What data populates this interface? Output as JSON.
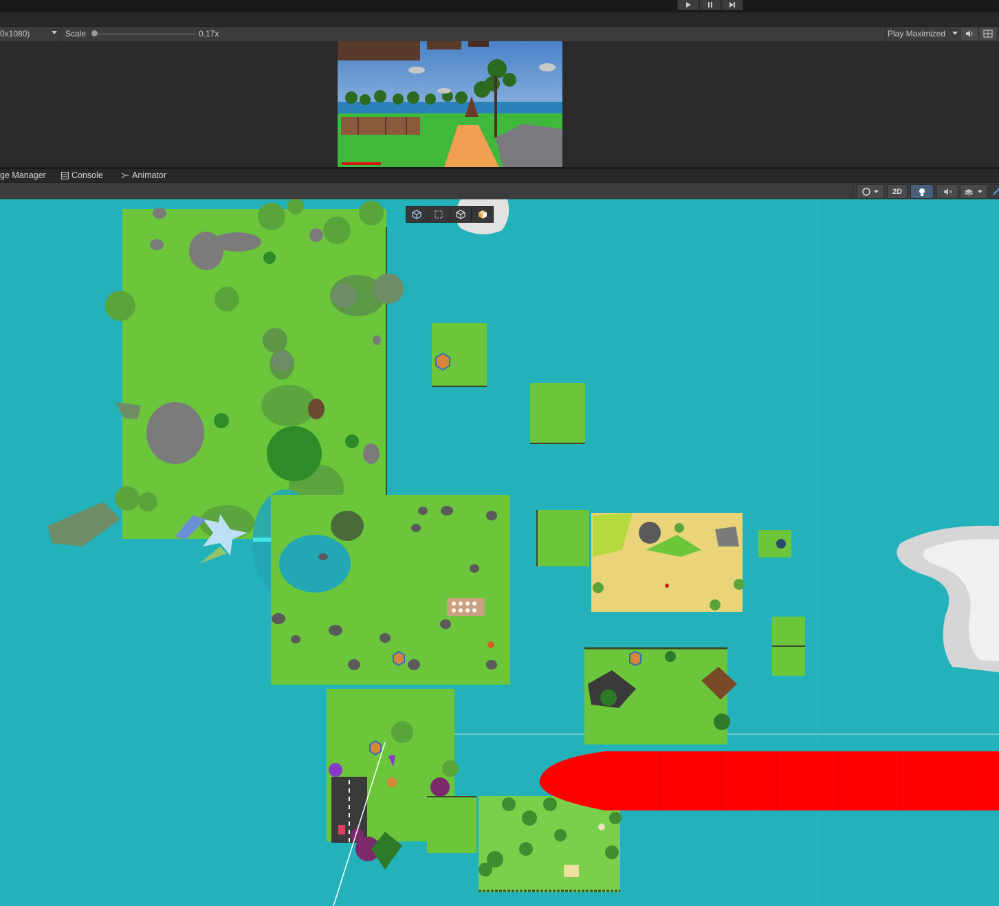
{
  "play_toolbar": {
    "play_icon": "play-icon",
    "pause_icon": "pause-icon",
    "step_icon": "step-icon"
  },
  "game_toolbar": {
    "resolution": "0x1080)",
    "scale_label": "Scale",
    "scale_value": "0.17x",
    "play_mode": "Play Maximized",
    "mute_icon": "speaker-icon",
    "stats_icon": "grid-icon"
  },
  "tabs": [
    {
      "label": "ge Manager",
      "icon": "none"
    },
    {
      "label": "Console",
      "icon": "console-icon"
    },
    {
      "label": "Animator",
      "icon": "animator-icon"
    }
  ],
  "scene_toolbar": {
    "shading_icon": "sphere-icon",
    "mode_2d": "2D",
    "lighting_icon": "lightbulb-icon",
    "audio_icon": "audio-mute-icon",
    "effects_icon": "layers-icon",
    "gizmo_icon": "wrench-icon"
  },
  "scene_overlay_tools": [
    "cube-icon",
    "rect-tool-icon",
    "cube-outline-icon",
    "cube-shaded-icon"
  ],
  "colors": {
    "water": "#23b1ba",
    "grass": "#6cc63c",
    "sand": "#e9d47a",
    "red_zone": "#ff0000",
    "rock": "#7b7b7b",
    "tree_dark": "#3f8d2e"
  }
}
